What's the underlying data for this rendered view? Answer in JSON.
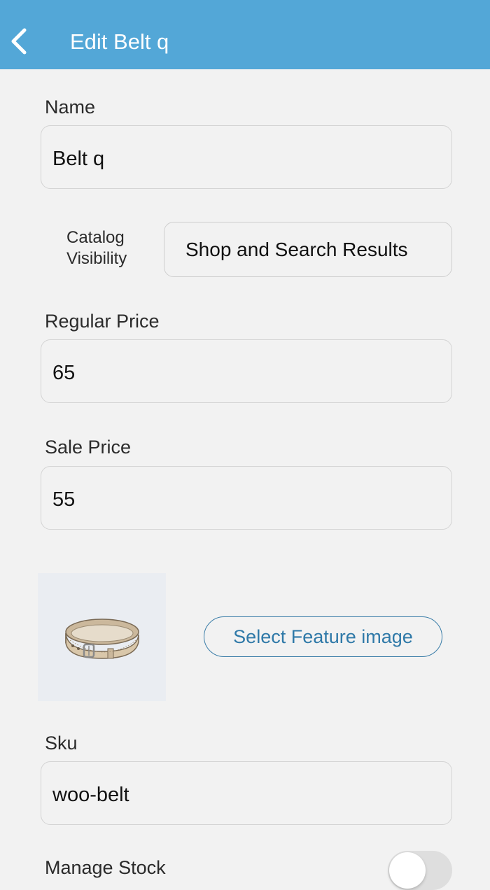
{
  "header": {
    "back_icon": "chevron-left-icon",
    "title": "Edit Belt q",
    "background_color": "#53a7d7"
  },
  "form": {
    "name": {
      "label": "Name",
      "value": "Belt q"
    },
    "catalog_visibility": {
      "label_line1": "Catalog",
      "label_line2": "Visibility",
      "selected": "Shop and Search Results"
    },
    "regular_price": {
      "label": "Regular Price",
      "value": "65"
    },
    "sale_price": {
      "label": "Sale Price",
      "value": "55"
    },
    "feature_image": {
      "button_label": "Select Feature image",
      "image": "belt-thumbnail"
    },
    "sku": {
      "label": "Sku",
      "value": "woo-belt"
    },
    "manage_stock": {
      "label": "Manage Stock",
      "enabled": false
    }
  }
}
